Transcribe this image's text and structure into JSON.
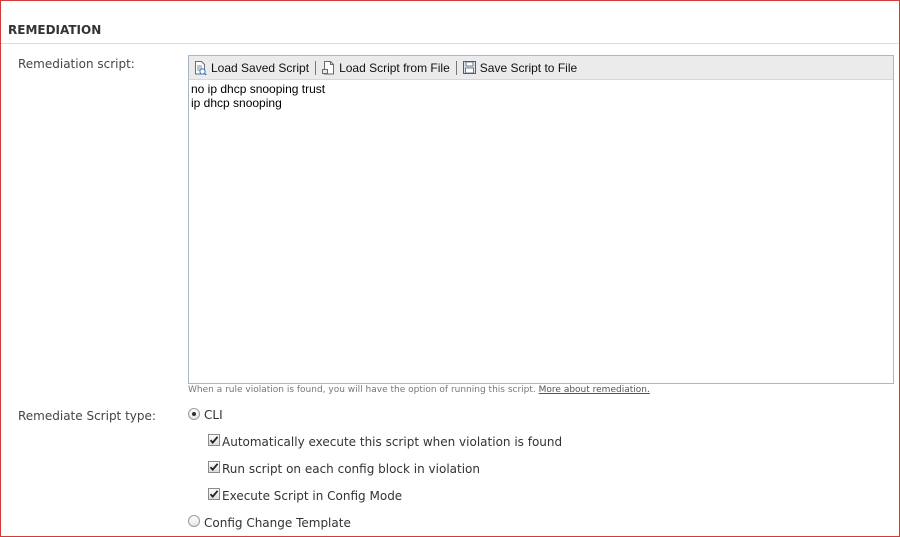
{
  "section": {
    "title": "REMEDIATION"
  },
  "remediation_script": {
    "label": "Remediation script:",
    "toolbar": {
      "load_saved": "Load Saved Script",
      "load_from_file": "Load Script from File",
      "save_to_file": "Save Script to File"
    },
    "content": "no ip dhcp snooping trust\nip dhcp snooping",
    "help_text": "When a rule violation is found, you will have the option of running this script.",
    "help_link": "More about remediation."
  },
  "script_type": {
    "label": "Remediate Script type:",
    "options": [
      {
        "label": "CLI",
        "selected": true
      },
      {
        "label": "Config Change Template",
        "selected": false
      }
    ],
    "cli_options": [
      {
        "label": "Automatically execute this script when violation is found",
        "checked": true
      },
      {
        "label": "Run script on each config block in violation",
        "checked": true
      },
      {
        "label": "Execute Script in Config Mode",
        "checked": true
      }
    ]
  }
}
